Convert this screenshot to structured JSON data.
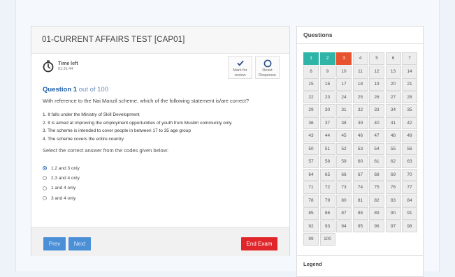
{
  "exam": {
    "title": "01-CURRENT AFFAIRS TEST [CAP01]",
    "timer": {
      "label": "Time left",
      "value": "01:31:44"
    },
    "tools": {
      "mark": "Mark for review",
      "reset": "Reset Response"
    },
    "question": {
      "number": "Question 1",
      "of": " out of 100",
      "text": "With reference to the Nai Manzil scheme, which of the following statement is/are correct?",
      "statements": [
        "1. It falls under the Ministry of Skill Development",
        "2. It is aimed at improving the employment opportunities of youth from Muslim community only.",
        "3. The scheme is intended to cover people in between 17 to 35 age group",
        "4.  The scheme covers the entire country."
      ],
      "instruction": "Select the correct answer from the codes given below:",
      "options": [
        {
          "label": "1,2 and 3 only",
          "selected": true
        },
        {
          "label": "2,3 and 4 only",
          "selected": false
        },
        {
          "label": "1 and 4 only",
          "selected": false
        },
        {
          "label": "3 and 4 only",
          "selected": false
        }
      ]
    },
    "footer": {
      "prev": "Prev",
      "next": "Next",
      "end": "End Exam"
    }
  },
  "sidebar": {
    "title": "Questions",
    "total": 100,
    "answered": [
      1,
      2
    ],
    "current": 3,
    "colors": {
      "answered": "#2fb5a7",
      "current": "#e8522e",
      "default": "#ededed"
    },
    "legend_title": "Legend"
  }
}
